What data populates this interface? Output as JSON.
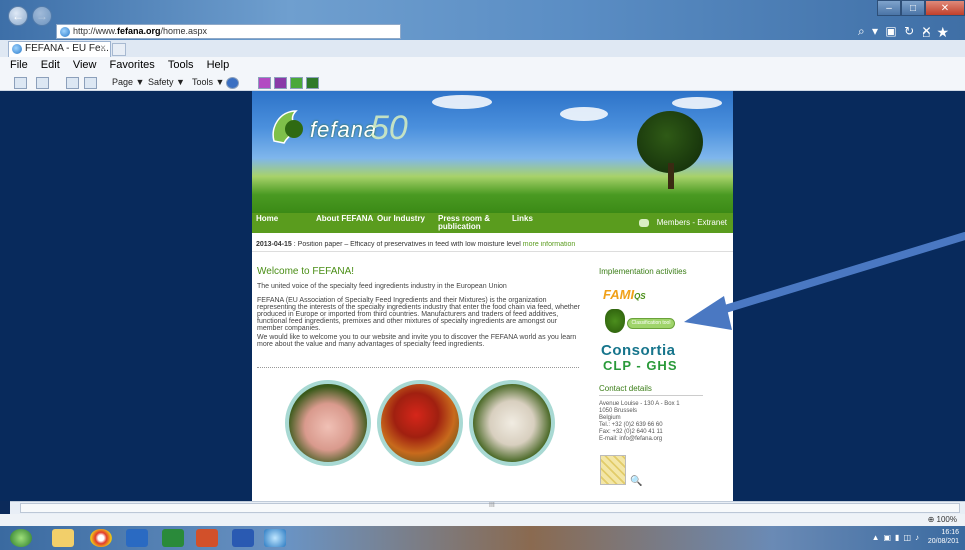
{
  "browser": {
    "url_prefix": "http://www.",
    "url_domain": "fefana.org",
    "url_path": "/home.aspx",
    "addr_right_icons": "⌕ ▾ ▣ ↻ ✕",
    "tab_title": "FEFANA - EU Fe...",
    "tab_close": "×",
    "menu": [
      "File",
      "Edit",
      "View",
      "Favorites",
      "Tools",
      "Help"
    ],
    "cmd_page": "Page ▼",
    "cmd_safety": "Safety ▼",
    "cmd_tools": "Tools ▼",
    "hscroll_mid": "III",
    "zoom": "⊕ 100%"
  },
  "site": {
    "logo_text": "fefana",
    "logo_50": "50",
    "nav": [
      "Home",
      "About FEFANA",
      "Our Industry",
      "Press room &\npublication",
      "Links"
    ],
    "members": "Members - Extranet",
    "ticker_date": "2013-04-15",
    "ticker_text": " : Position paper – Efficacy of preservatives in feed with low moisture level ",
    "ticker_more": "more information",
    "welcome_title": "Welcome to FEFANA!",
    "para1": "The united voice of the specialty feed ingredients industry in the European Union",
    "para2": "FEFANA (EU Association of Specialty Feed Ingredients and their Mixtures) is the organization representing the interests of the specialty ingredients industry that enter the food chain via feed, whether produced in Europe or imported from third countries. Manufacturers and traders of feed additives, functional feed ingredients, premixes and other mixtures of specialty ingredients are amongst our member companies.",
    "para3": "We would like to welcome you to our website and invite you to discover the FEFANA world as you learn more about the value and many advantages of specialty feed ingredients.",
    "implementation_title": "Implementation activities",
    "fami": "FAMI",
    "fami_qs": "QS",
    "classification_label": "Classification tool",
    "consortia": "Consortia",
    "clp": "CLP - GHS",
    "contact_title": "Contact details",
    "address": [
      "Avenue Louise - 130 A - Box 1",
      "1050 Brussels",
      "Belgium",
      "Tel.: +32 (0)2 639 66 60",
      "Fax: +32 (0)2 640 41 11",
      "E-mail: info@fefana.org"
    ]
  },
  "taskbar": {
    "time": "16:16",
    "date": "20/08/201"
  },
  "colors": {
    "nav_green": "#5a9c1e",
    "page_bg": "#082a5c",
    "arrow": "#4a78c2"
  }
}
